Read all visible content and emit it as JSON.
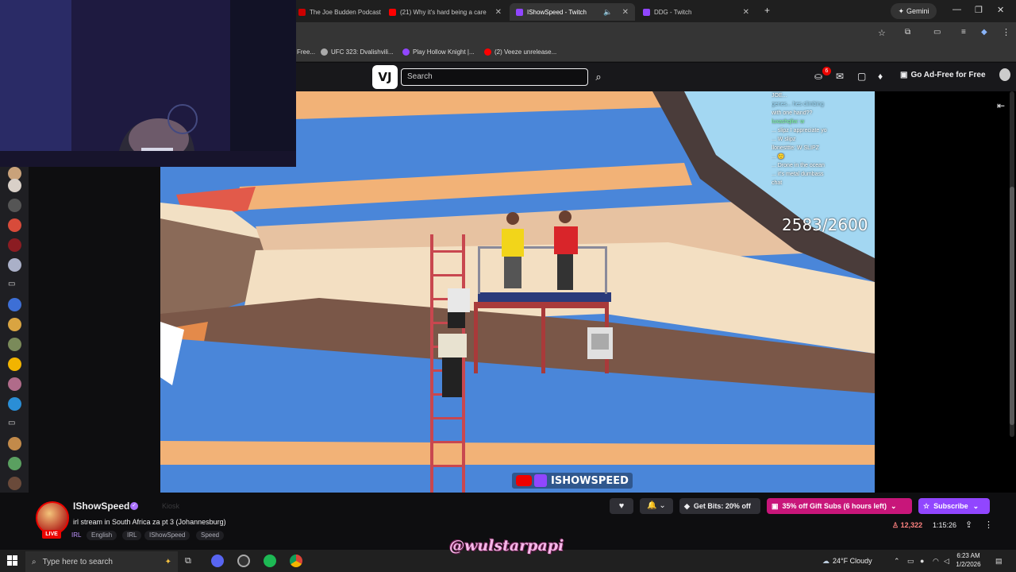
{
  "browser": {
    "tabs": [
      {
        "label": "The Joe Budden Podcast E",
        "favicon_color": "#cc0000"
      },
      {
        "label": "(21) Why it's hard being a care",
        "favicon_color": "#ff0000"
      },
      {
        "label": "IShowSpeed - Twitch",
        "favicon_color": "#9146ff",
        "active": true
      },
      {
        "label": "DDG - Twitch",
        "favicon_color": "#9146ff"
      }
    ],
    "new_tab_label": "+",
    "gemini_label": "Gemini",
    "bookmarks": [
      {
        "label": "Free...",
        "color": "#888888"
      },
      {
        "label": "UFC 323: Dvalishvili...",
        "color": "#aaaaaa"
      },
      {
        "label": "Play Hollow Knight |...",
        "color": "#9146ff"
      },
      {
        "label": "(2) Veeze unrelease...",
        "color": "#ff0000"
      }
    ]
  },
  "twitch": {
    "logo_text": "VJ",
    "search_placeholder": "Search",
    "notification_count": "6",
    "ad_free_label": "Go Ad-Free for Free"
  },
  "video": {
    "counter": "2583/2600",
    "chat_overlay": [
      "JOE...",
      "genes... hes climbing",
      "with one hand??",
      "luxashqliw: w",
      "... slipz I appreciate yo",
      "... W slipz",
      "llonesttte: W SLIPZ",
      "... 🙂",
      "... Drone in the ocean",
      "... it's metal dumbass",
      "chat"
    ],
    "watermark": "ISHOWSPEED"
  },
  "channel": {
    "name": "IShowSpeed",
    "live_label": "LIVE",
    "kiosk_label": "Kiosk",
    "stream_title": "irl stream in South Africa za pt 3 (Johannesburg)",
    "tags": [
      "IRL",
      "English",
      "IRL",
      "IShowSpeed",
      "Speed"
    ],
    "get_bits_label": "Get Bits: 20% off",
    "gift_subs_label": "35% off Gift Subs (6 hours left)",
    "subscribe_label": "Subscribe",
    "viewer_count": "12,322",
    "uptime": "1:15:26"
  },
  "taskbar": {
    "search_placeholder": "Type here to search",
    "weather": "24°F  Cloudy",
    "time": "6:23 AM",
    "date": "1/2/2026",
    "handle_overlay": "@wulstarpapi"
  }
}
